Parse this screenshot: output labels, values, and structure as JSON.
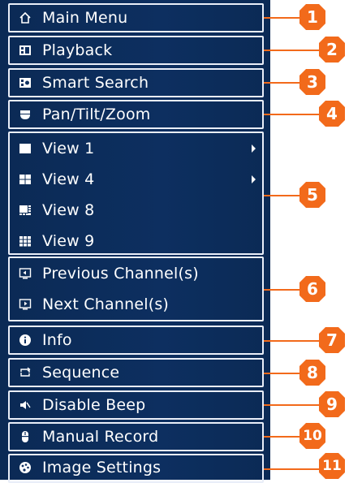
{
  "menu": {
    "items": [
      {
        "label": "Main Menu",
        "icon": "home-icon"
      },
      {
        "label": "Playback",
        "icon": "playback-icon"
      },
      {
        "label": "Smart Search",
        "icon": "smart-search-icon"
      },
      {
        "label": "Pan/Tilt/Zoom",
        "icon": "ptz-icon"
      },
      {
        "label": "View 1",
        "icon": "view1-icon",
        "submenu": true
      },
      {
        "label": "View 4",
        "icon": "view4-icon",
        "submenu": true
      },
      {
        "label": "View 8",
        "icon": "view8-icon"
      },
      {
        "label": "View 9",
        "icon": "view9-icon"
      },
      {
        "label": "Previous Channel(s)",
        "icon": "previous-channel-icon"
      },
      {
        "label": "Next Channel(s)",
        "icon": "next-channel-icon"
      },
      {
        "label": "Info",
        "icon": "info-icon"
      },
      {
        "label": "Sequence",
        "icon": "sequence-icon"
      },
      {
        "label": "Disable Beep",
        "icon": "beep-mute-icon"
      },
      {
        "label": "Manual Record",
        "icon": "manual-record-icon"
      },
      {
        "label": "Image Settings",
        "icon": "image-settings-icon"
      }
    ]
  },
  "callouts": [
    "1",
    "2",
    "3",
    "4",
    "5",
    "6",
    "7",
    "8",
    "9",
    "10",
    "11"
  ],
  "colors": {
    "panel": "#0d2f60",
    "border": "#e9eef8",
    "accent": "#f26a1b"
  }
}
